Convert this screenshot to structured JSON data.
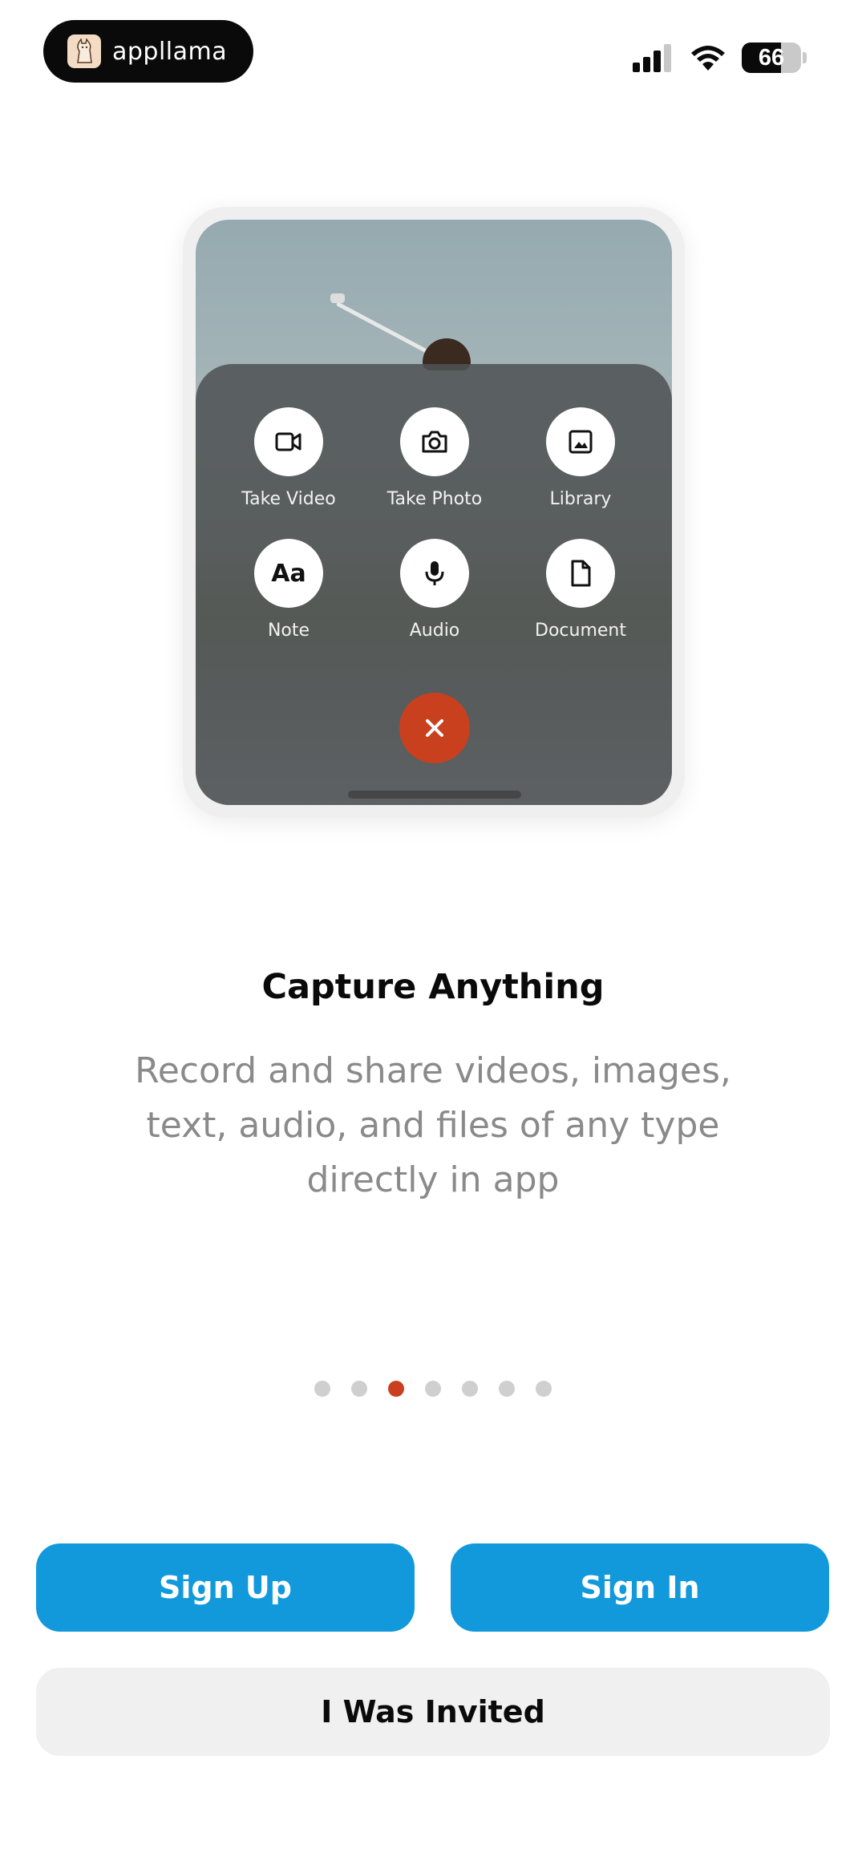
{
  "status_bar": {
    "app_pill_label": "appllama",
    "battery_level": "66",
    "battery_fraction": 0.66,
    "icons": [
      "cellular-signal-icon",
      "wifi-icon",
      "battery-icon"
    ]
  },
  "preview": {
    "actions": [
      {
        "label": "Take Video",
        "icon": "video-icon"
      },
      {
        "label": "Take Photo",
        "icon": "camera-icon"
      },
      {
        "label": "Library",
        "icon": "image-icon"
      },
      {
        "label": "Note",
        "icon": "text-aa-icon",
        "glyph": "Aa"
      },
      {
        "label": "Audio",
        "icon": "microphone-icon"
      },
      {
        "label": "Document",
        "icon": "document-icon"
      }
    ],
    "close_icon": "close-icon"
  },
  "onboarding": {
    "title": "Capture Anything",
    "description": "Record and share videos, images, text, audio, and files of any type directly in app",
    "page_count": 7,
    "current_page": 3
  },
  "buttons": {
    "sign_up": "Sign Up",
    "sign_in": "Sign In",
    "invited": "I Was Invited"
  },
  "colors": {
    "accent": "#c9401f",
    "primary_button": "#1299dc",
    "secondary_button": "#f0f0f0",
    "description_text": "#8a8a8a"
  }
}
